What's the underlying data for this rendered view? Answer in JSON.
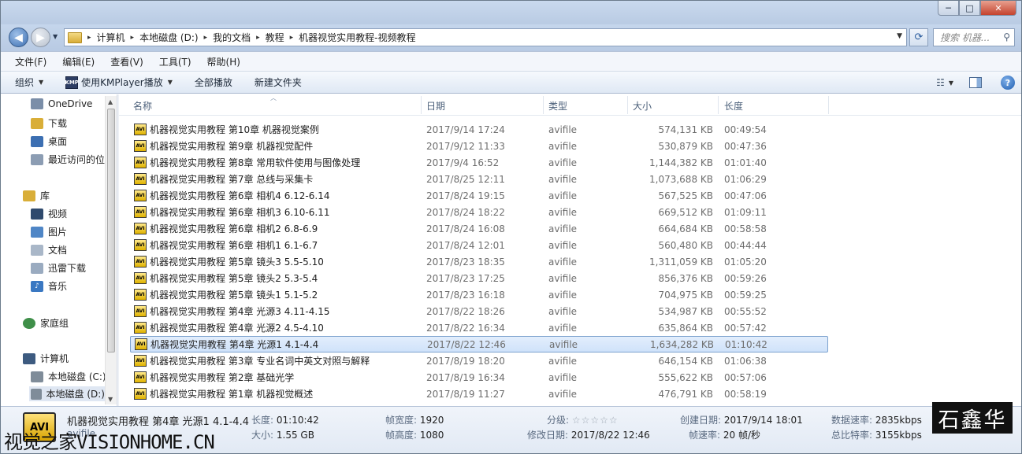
{
  "window": {
    "caption_buttons": {
      "minimize": "─",
      "maximize": "□",
      "close": "✕"
    }
  },
  "nav": {
    "back_glyph": "◀",
    "forward_glyph": "▶",
    "breadcrumb": [
      "计算机",
      "本地磁盘 (D:)",
      "我的文档",
      "教程",
      "机器视觉实用教程-视频教程"
    ],
    "search_placeholder": "搜索 机器...",
    "refresh_glyph": "⟳"
  },
  "menu": [
    "文件(F)",
    "编辑(E)",
    "查看(V)",
    "工具(T)",
    "帮助(H)"
  ],
  "commands": {
    "organize": "组织",
    "play_with": "使用KMPlayer播放",
    "play_all": "全部播放",
    "new_folder": "新建文件夹",
    "km_icon_text": "KMP"
  },
  "sidebar": {
    "items": [
      {
        "label": "OneDrive",
        "icon": "cloud-icon",
        "color": "#7b8ea8"
      },
      {
        "label": "下载",
        "icon": "download-folder-icon",
        "color": "#d9ae38"
      },
      {
        "label": "桌面",
        "icon": "desktop-icon",
        "color": "#3c6fb2"
      },
      {
        "label": "最近访问的位",
        "icon": "recent-places-icon",
        "color": "#8c9db3"
      },
      {
        "label": "库",
        "icon": "library-icon",
        "color": "#d9ae38"
      },
      {
        "label": "视频",
        "icon": "video-library-icon",
        "color": "#2f4a6d"
      },
      {
        "label": "图片",
        "icon": "pictures-library-icon",
        "color": "#4f86c6"
      },
      {
        "label": "文档",
        "icon": "documents-library-icon",
        "color": "#a9b7c8"
      },
      {
        "label": "迅雷下载",
        "icon": "thunder-download-icon",
        "color": "#9aabc0"
      },
      {
        "label": "音乐",
        "icon": "music-library-icon",
        "color": "#3a78c2"
      },
      {
        "label": "家庭组",
        "icon": "homegroup-icon",
        "color": "#3f8f49"
      },
      {
        "label": "计算机",
        "icon": "computer-icon",
        "color": "#3d5b80"
      },
      {
        "label": "本地磁盘 (C:)",
        "icon": "drive-c-icon",
        "color": "#7f8c99"
      },
      {
        "label": "本地磁盘 (D:)",
        "icon": "drive-d-icon",
        "color": "#7f8c99"
      }
    ]
  },
  "columns": {
    "name": "名称",
    "date": "日期",
    "type": "类型",
    "size": "大小",
    "duration": "长度"
  },
  "files": [
    {
      "name": "机器视觉实用教程 第10章 机器视觉案例",
      "date": "2017/9/14 17:24",
      "type": "avifile",
      "size": "574,131 KB",
      "duration": "00:49:54",
      "selected": false
    },
    {
      "name": "机器视觉实用教程 第9章 机器视觉配件",
      "date": "2017/9/12 11:33",
      "type": "avifile",
      "size": "530,879 KB",
      "duration": "00:47:36",
      "selected": false
    },
    {
      "name": "机器视觉实用教程 第8章 常用软件使用与图像处理",
      "date": "2017/9/4 16:52",
      "type": "avifile",
      "size": "1,144,382 KB",
      "duration": "01:01:40",
      "selected": false
    },
    {
      "name": "机器视觉实用教程 第7章 总线与采集卡",
      "date": "2017/8/25 12:11",
      "type": "avifile",
      "size": "1,073,688 KB",
      "duration": "01:06:29",
      "selected": false
    },
    {
      "name": "机器视觉实用教程 第6章 相机4 6.12-6.14",
      "date": "2017/8/24 19:15",
      "type": "avifile",
      "size": "567,525 KB",
      "duration": "00:47:06",
      "selected": false
    },
    {
      "name": "机器视觉实用教程 第6章 相机3 6.10-6.11",
      "date": "2017/8/24 18:22",
      "type": "avifile",
      "size": "669,512 KB",
      "duration": "01:09:11",
      "selected": false
    },
    {
      "name": "机器视觉实用教程 第6章 相机2 6.8-6.9",
      "date": "2017/8/24 16:08",
      "type": "avifile",
      "size": "664,684 KB",
      "duration": "00:58:58",
      "selected": false
    },
    {
      "name": "机器视觉实用教程 第6章 相机1 6.1-6.7",
      "date": "2017/8/24 12:01",
      "type": "avifile",
      "size": "560,480 KB",
      "duration": "00:44:44",
      "selected": false
    },
    {
      "name": "机器视觉实用教程 第5章 镜头3 5.5-5.10",
      "date": "2017/8/23 18:35",
      "type": "avifile",
      "size": "1,311,059 KB",
      "duration": "01:05:20",
      "selected": false
    },
    {
      "name": "机器视觉实用教程 第5章 镜头2 5.3-5.4",
      "date": "2017/8/23 17:25",
      "type": "avifile",
      "size": "856,376 KB",
      "duration": "00:59:26",
      "selected": false
    },
    {
      "name": "机器视觉实用教程 第5章 镜头1 5.1-5.2",
      "date": "2017/8/23 16:18",
      "type": "avifile",
      "size": "704,975 KB",
      "duration": "00:59:25",
      "selected": false
    },
    {
      "name": "机器视觉实用教程 第4章 光源3 4.11-4.15",
      "date": "2017/8/22 18:26",
      "type": "avifile",
      "size": "534,987 KB",
      "duration": "00:55:52",
      "selected": false
    },
    {
      "name": "机器视觉实用教程 第4章 光源2 4.5-4.10",
      "date": "2017/8/22 16:34",
      "type": "avifile",
      "size": "635,864 KB",
      "duration": "00:57:42",
      "selected": false
    },
    {
      "name": "机器视觉实用教程 第4章 光源1 4.1-4.4",
      "date": "2017/8/22 12:46",
      "type": "avifile",
      "size": "1,634,282 KB",
      "duration": "01:10:42",
      "selected": true
    },
    {
      "name": "机器视觉实用教程 第3章 专业名词中英文对照与解释",
      "date": "2017/8/19 18:20",
      "type": "avifile",
      "size": "646,154 KB",
      "duration": "01:06:38",
      "selected": false
    },
    {
      "name": "机器视觉实用教程 第2章 基础光学",
      "date": "2017/8/19 16:34",
      "type": "avifile",
      "size": "555,622 KB",
      "duration": "00:57:06",
      "selected": false
    },
    {
      "name": "机器视觉实用教程 第1章 机器视觉概述",
      "date": "2017/8/19 11:27",
      "type": "avifile",
      "size": "476,791 KB",
      "duration": "00:58:19",
      "selected": false
    }
  ],
  "row_icon_text": "AVI",
  "details": {
    "icon_text": "AVI",
    "title": "机器视觉实用教程 第4章 光源1 4.1-4.4",
    "subtitle": "avifile",
    "length_label": "长度:",
    "length": "01:10:42",
    "size_label": "大小:",
    "size": "1.55 GB",
    "frame_width_label": "帧宽度:",
    "frame_width": "1920",
    "frame_height_label": "帧高度:",
    "frame_height": "1080",
    "rating_label": "分级:",
    "rating_stars": "☆☆☆☆☆",
    "rating": 0,
    "modified_label": "修改日期:",
    "modified": "2017/8/22 12:46",
    "created_label": "创建日期:",
    "created": "2017/9/14 18:01",
    "frame_rate_label": "帧速率:",
    "frame_rate": "20 帧/秒",
    "data_rate_label": "数据速率:",
    "data_rate": "2835kbps",
    "total_bitrate_label": "总比特率:",
    "total_bitrate": "3155kbps"
  },
  "watermarks": {
    "left": "视觉之家VISIONHOME.CN",
    "right": "石鑫华"
  }
}
